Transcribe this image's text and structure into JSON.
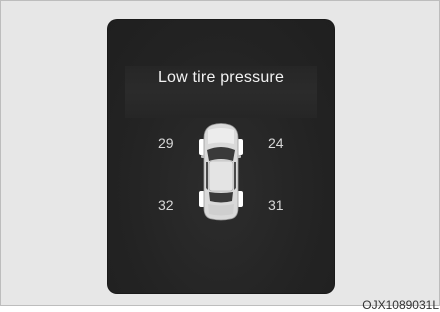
{
  "display": {
    "title": "Low tire pressure",
    "tires": {
      "front_left": "29",
      "front_right": "24",
      "rear_left": "32",
      "rear_right": "31"
    }
  },
  "figure_code": "OJX1089031L",
  "colors": {
    "screen_background": "#232323",
    "page_background": "#e7e7e7",
    "text": "#f2f2f2",
    "tire_highlight": "#ffffff"
  },
  "icons": {
    "vehicle": "car-top-view-icon"
  }
}
